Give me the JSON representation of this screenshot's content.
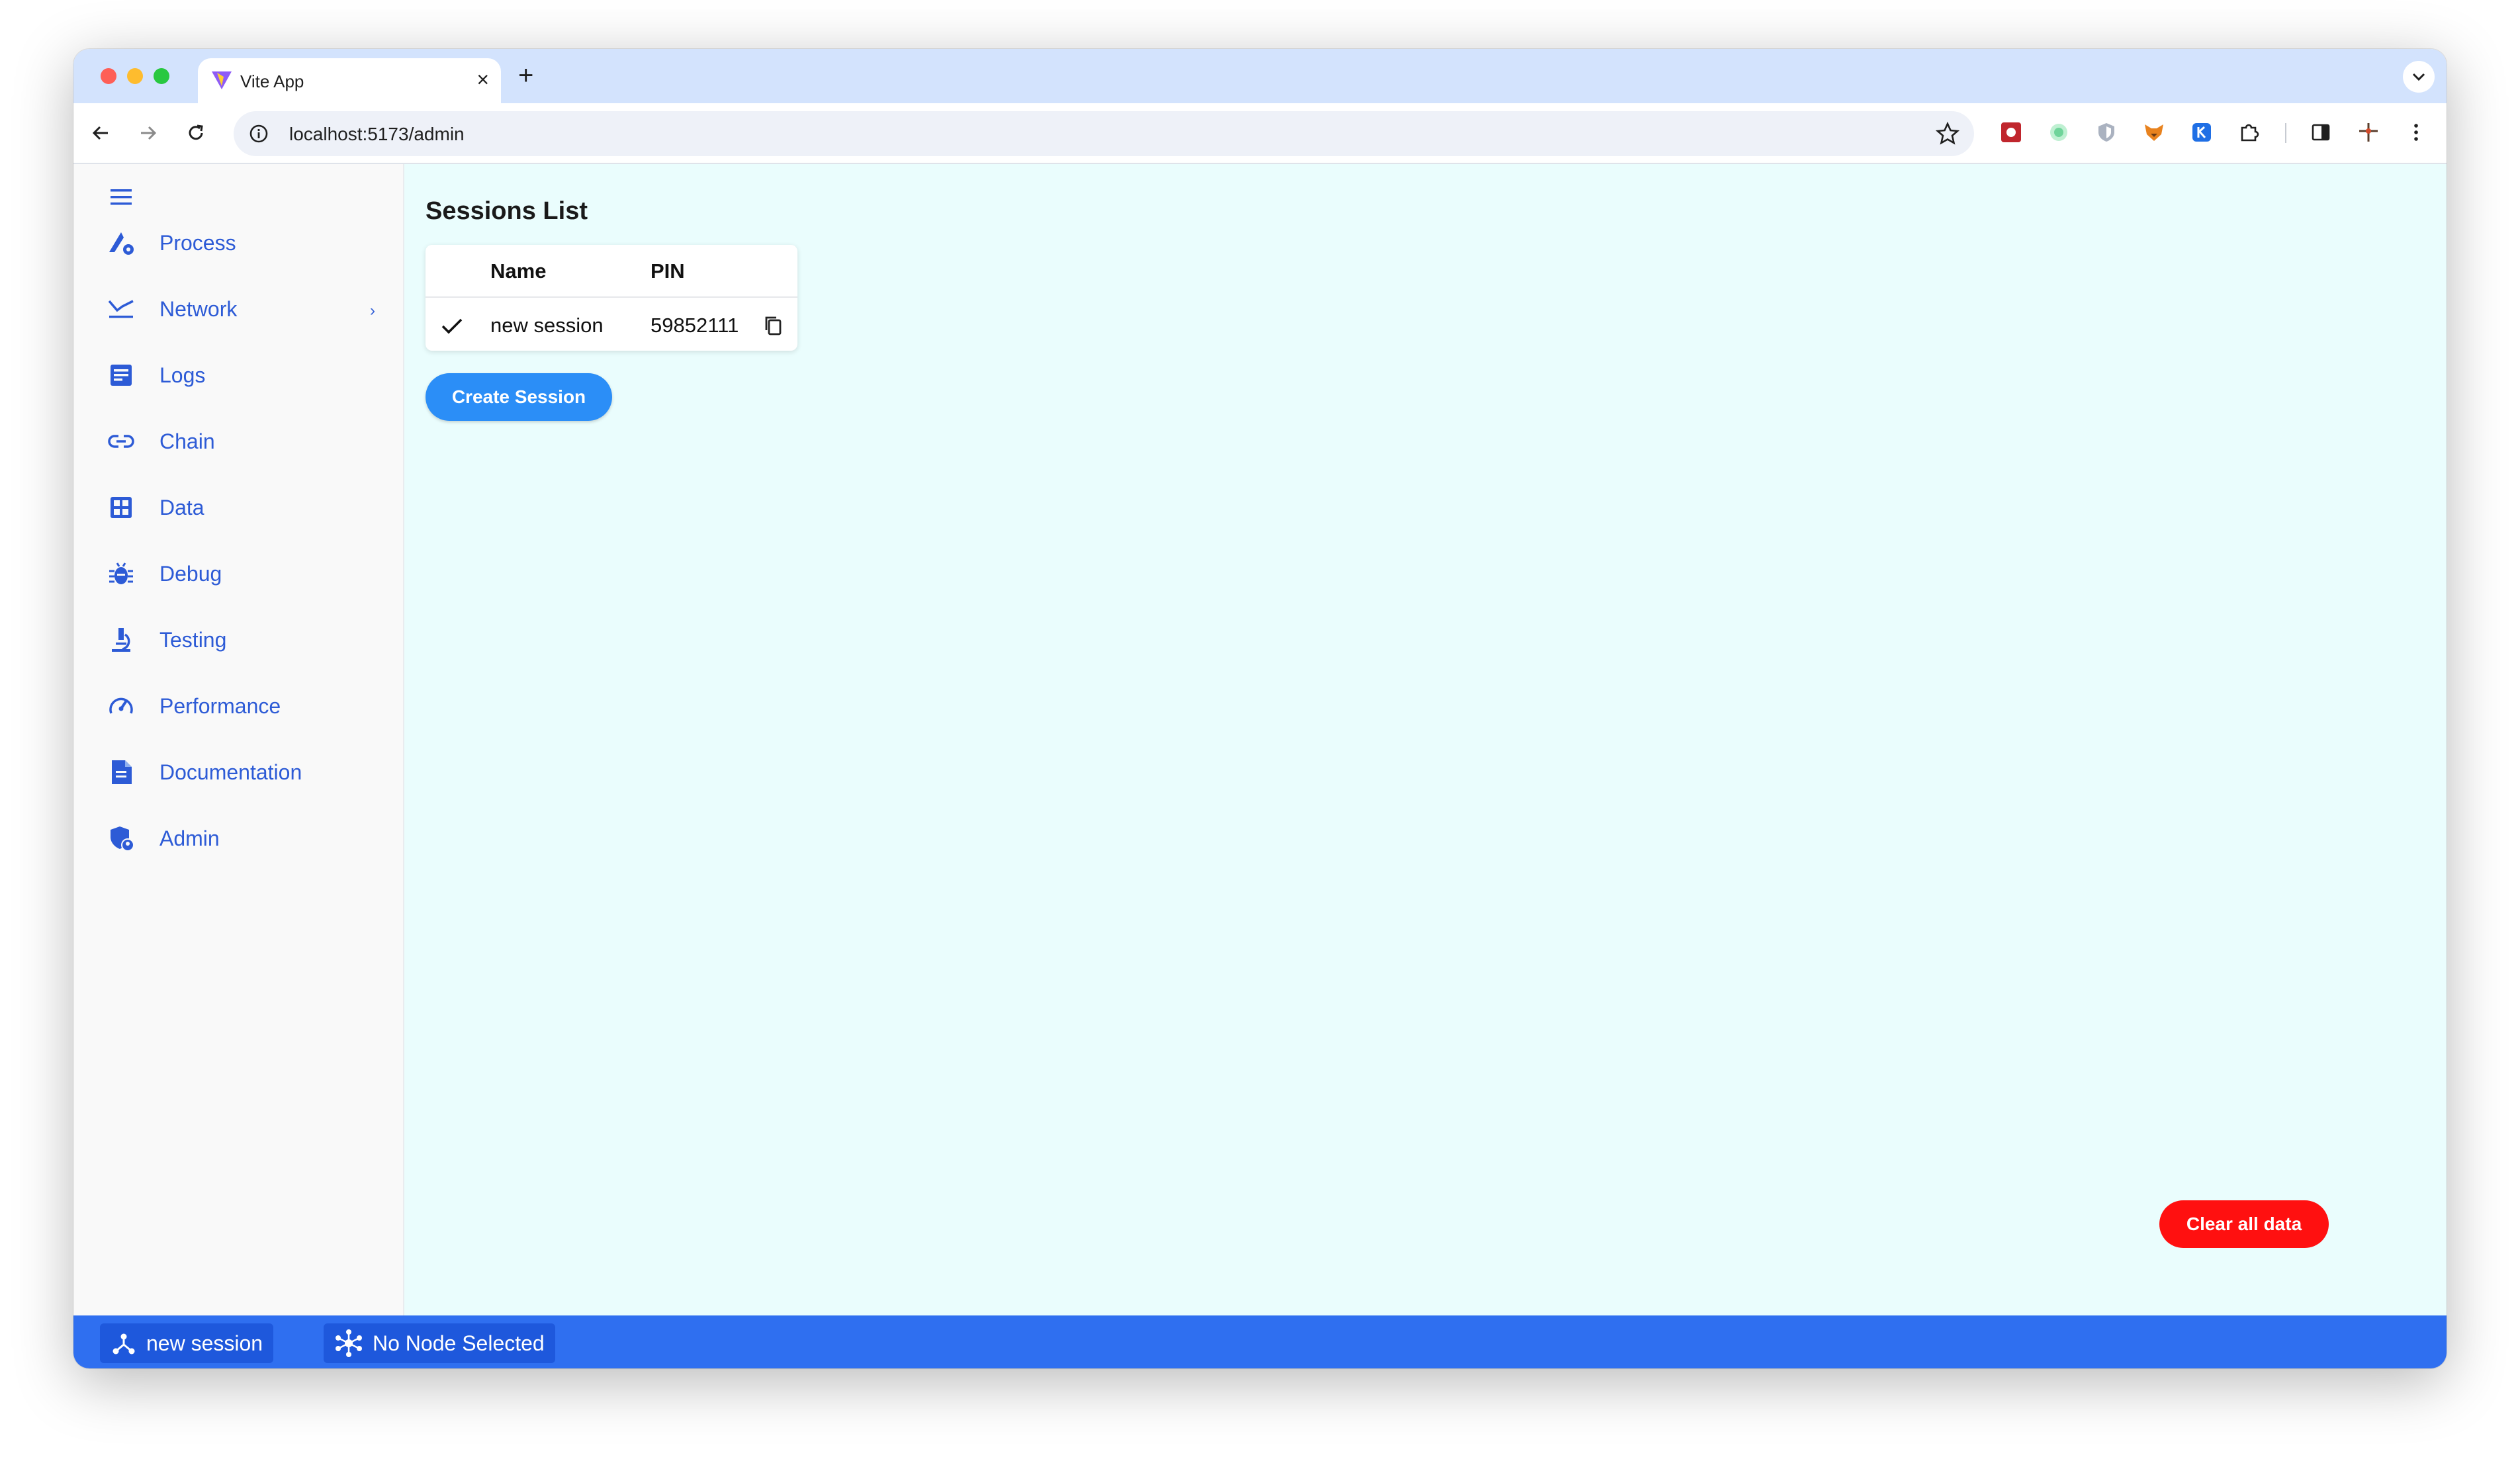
{
  "browser": {
    "tab_title": "Vite App",
    "tab_close": "×",
    "new_tab": "+",
    "url": "localhost:5173/admin"
  },
  "sidebar": {
    "items": [
      {
        "label": "Process",
        "icon": "process-icon"
      },
      {
        "label": "Network",
        "icon": "network-icon",
        "chevron": "›"
      },
      {
        "label": "Logs",
        "icon": "logs-icon"
      },
      {
        "label": "Chain",
        "icon": "chain-link-icon"
      },
      {
        "label": "Data",
        "icon": "data-grid-icon"
      },
      {
        "label": "Debug",
        "icon": "bug-icon"
      },
      {
        "label": "Testing",
        "icon": "microscope-icon"
      },
      {
        "label": "Performance",
        "icon": "gauge-icon"
      },
      {
        "label": "Documentation",
        "icon": "document-icon"
      },
      {
        "label": "Admin",
        "icon": "shield-admin-icon"
      }
    ]
  },
  "main": {
    "title": "Sessions List",
    "table": {
      "headers": [
        "Name",
        "PIN"
      ],
      "rows": [
        {
          "selected": true,
          "name": "new session",
          "pin": "59852111"
        }
      ]
    },
    "create_button": "Create Session",
    "clear_button": "Clear all data"
  },
  "status_bar": {
    "session": "new session",
    "node": "No Node Selected"
  },
  "colors": {
    "accent": "#2d5bd6",
    "primary_button": "#2b8ef7",
    "danger_button": "#ff1010",
    "status_bar": "#2f6ff0",
    "content_bg": "#eafdfd"
  }
}
